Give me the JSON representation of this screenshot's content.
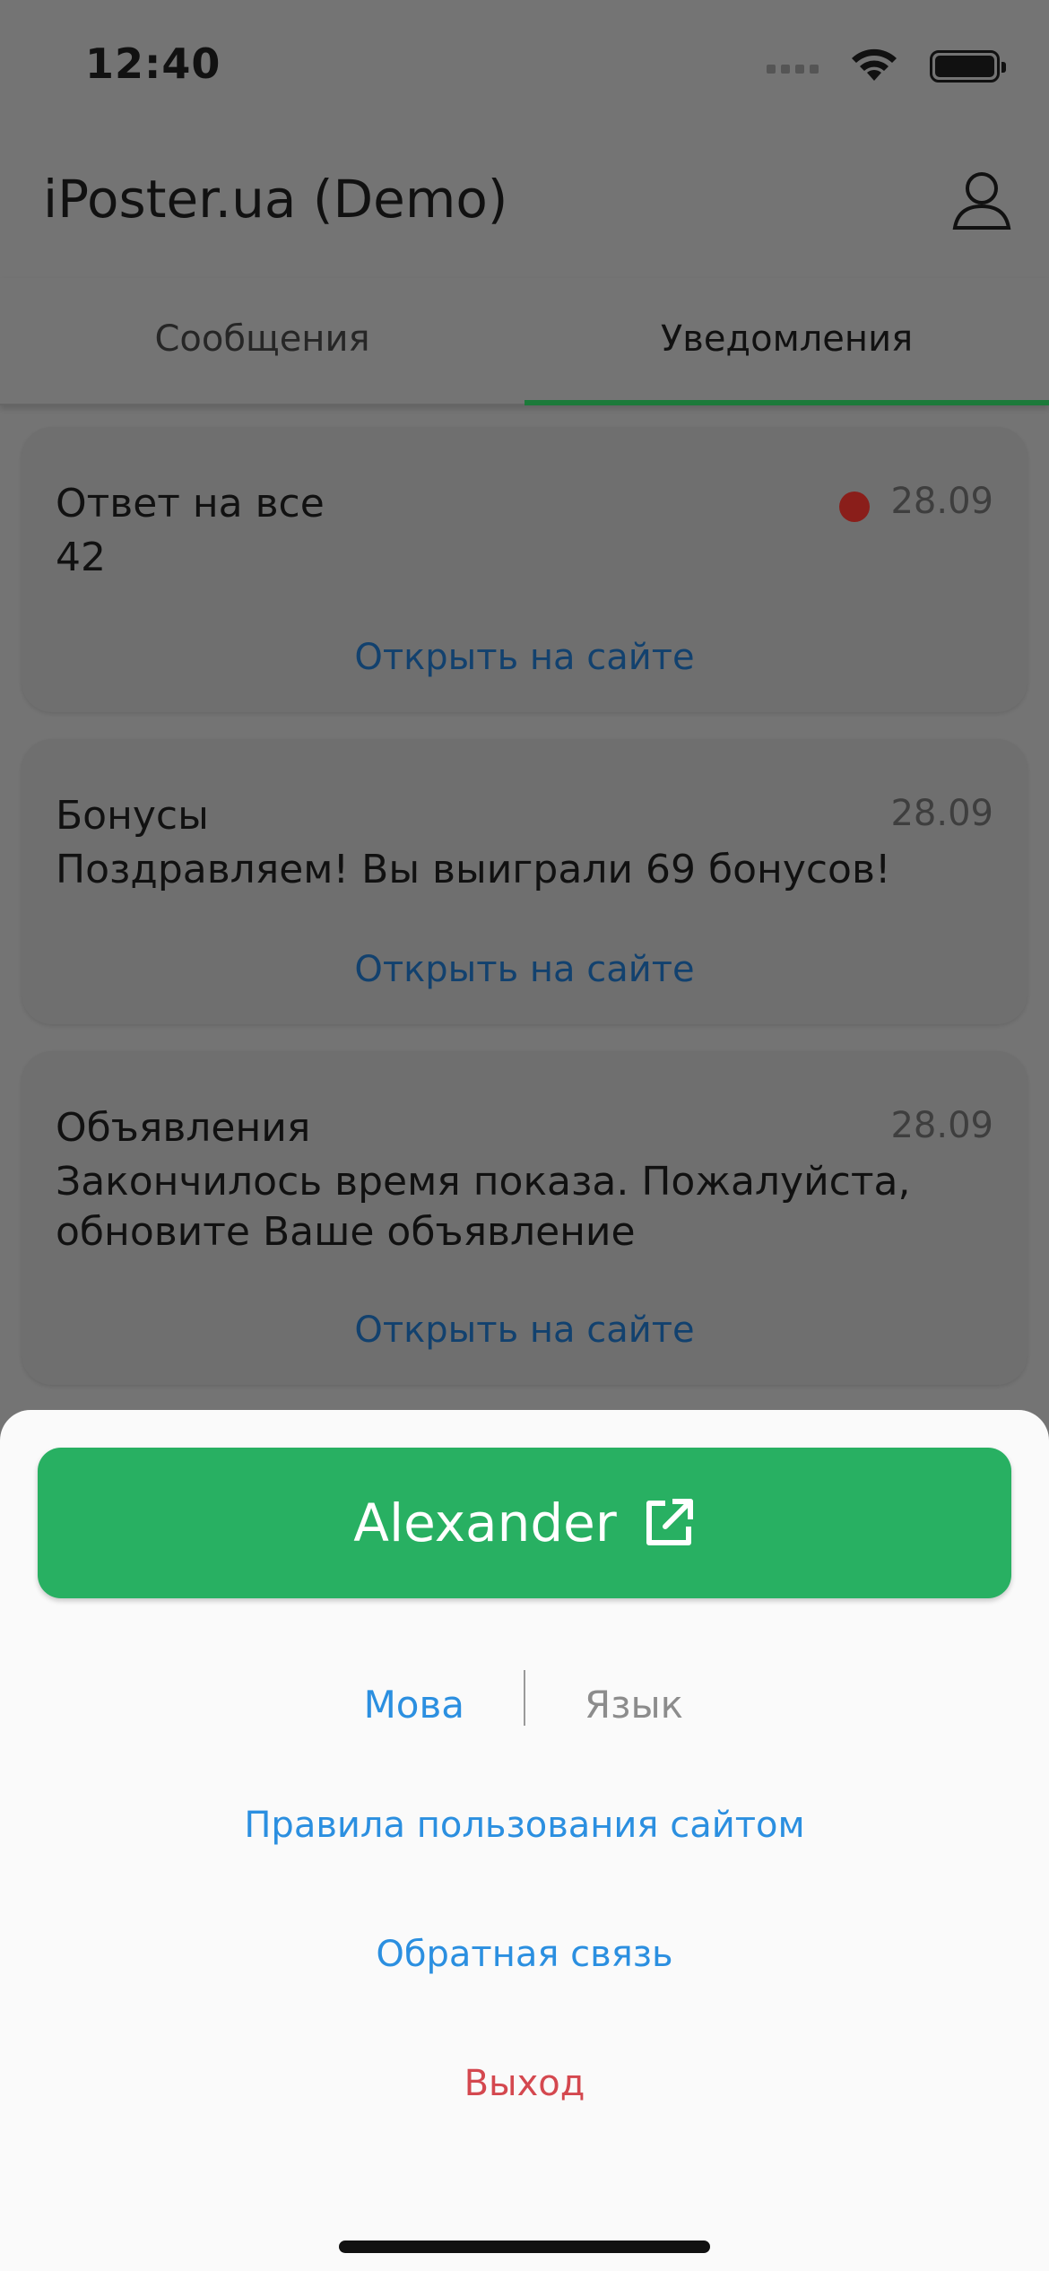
{
  "status_bar": {
    "time": "12:40"
  },
  "app_bar": {
    "title": "iPoster.ua (Demo)"
  },
  "tabs": [
    {
      "label": "Сообщения",
      "active": false
    },
    {
      "label": "Уведомления",
      "active": true
    }
  ],
  "notifications": [
    {
      "title": "Ответ на все",
      "date": "28.09",
      "unread": true,
      "body": "42",
      "link": "Открыть на сайте"
    },
    {
      "title": "Бонусы",
      "date": "28.09",
      "unread": false,
      "body": "Поздравляем! Вы выиграли 69 бонусов!",
      "link": "Открыть на сайте"
    },
    {
      "title": "Объявления",
      "date": "28.09",
      "unread": false,
      "body": "Закончилось время показа. Пожалуйста, обновите Ваше объявление",
      "link": "Открыть на сайте"
    }
  ],
  "sheet": {
    "user_button": "Alexander",
    "language": {
      "ua": "Мова",
      "ru": "Язык",
      "selected": "ua"
    },
    "rules_link": "Правила пользования сайтом",
    "feedback_link": "Обратная связь",
    "logout_link": "Выход"
  },
  "colors": {
    "accent_green": "#28b062",
    "link_blue": "#2b8fe0",
    "logout_red": "#d4484f",
    "unread_red": "#c0332a"
  }
}
